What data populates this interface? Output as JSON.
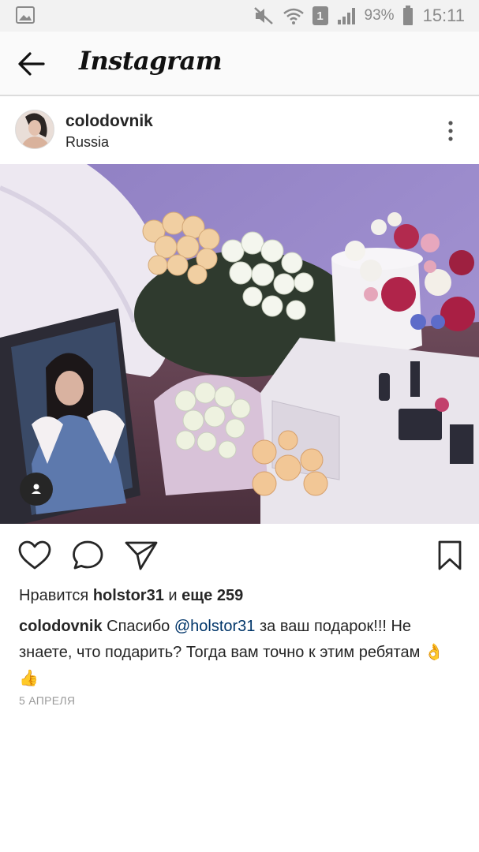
{
  "status_bar": {
    "battery_percent": "93%",
    "time": "15:11",
    "sim_slot": "1",
    "icons": [
      "gallery-icon",
      "mute-icon",
      "wifi-icon",
      "sim-icon",
      "signal-icon",
      "battery-icon"
    ]
  },
  "header": {
    "title": "Instagram",
    "back_icon": "arrow-left-icon"
  },
  "post": {
    "username": "colodovnik",
    "location": "Russia",
    "likes": {
      "prefix": "Нравится ",
      "liker": "holstor31",
      "connector": " и ",
      "others": "еще 259"
    },
    "caption": {
      "user": "colodovnik",
      "text_before": " Спасибо ",
      "mention": "@holstor31",
      "text_after": " за ваш подарок!!! Не знаете, что подарить? Тогда вам точно к этим ребятам 👌",
      "emoji_tail": "👍"
    },
    "date": "5 АПРЕЛЯ"
  },
  "colors": {
    "text": "#262626",
    "mention": "#003569",
    "muted": "#999999",
    "status_bar_bg": "#f2f2f2"
  }
}
